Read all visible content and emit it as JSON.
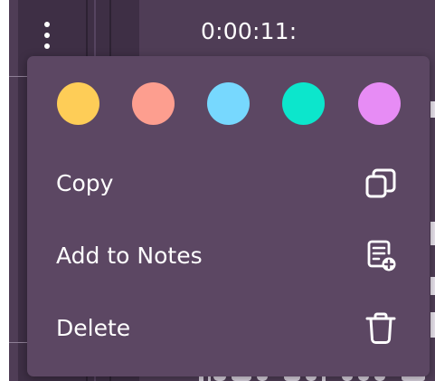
{
  "player": {
    "timestamp": "0:00:11:"
  },
  "context_menu": {
    "colors": [
      {
        "name": "yellow",
        "hex": "#fecd57"
      },
      {
        "name": "salmon",
        "hex": "#fd9e8f"
      },
      {
        "name": "sky-blue",
        "hex": "#77d8fe"
      },
      {
        "name": "teal",
        "hex": "#0ce6cc"
      },
      {
        "name": "violet",
        "hex": "#e78cf5"
      }
    ],
    "items": [
      {
        "label": "Copy",
        "icon": "copy-icon"
      },
      {
        "label": "Add to Notes",
        "icon": "add-note-icon"
      },
      {
        "label": "Delete",
        "icon": "trash-icon"
      }
    ]
  },
  "theme": {
    "menu_bg": "#5c4763",
    "panel_bg": "#4f3d56",
    "text": "#ffffff"
  }
}
